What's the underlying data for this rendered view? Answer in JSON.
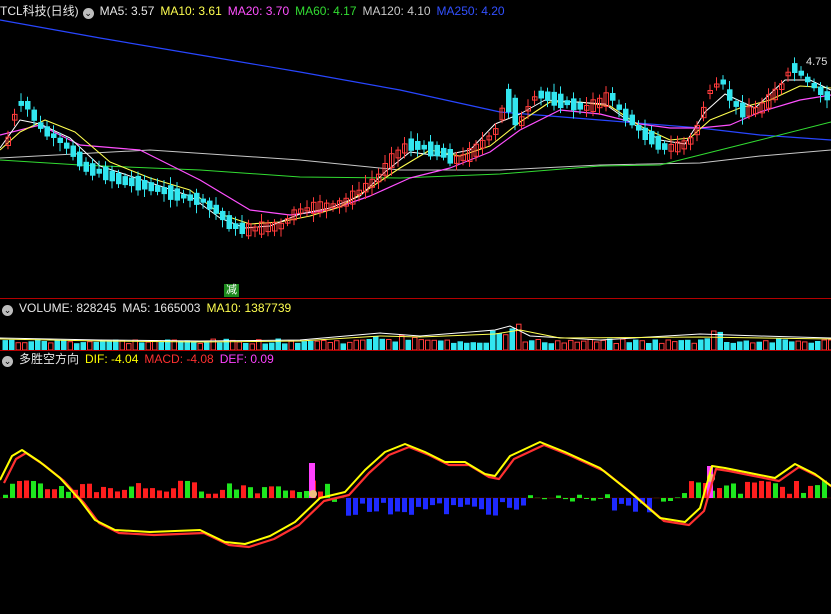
{
  "colors": {
    "background": "#000000",
    "up": "#ff3c3c",
    "down": "#32e6f0",
    "ma5": "#ffffff",
    "ma10": "#ffff50",
    "ma20": "#ff50ff",
    "ma60": "#32dc32",
    "ma120": "#c8c8c8",
    "ma250": "#2846ff",
    "dif": "#ffff00",
    "macd": "#ff3030",
    "def": "#ff40ff",
    "bar_red": "#ff1e1e",
    "bar_green": "#1ee61e",
    "bar_blue": "#1e2aff"
  },
  "header_price": {
    "title": "TCL科技(日线)",
    "ma5": "MA5: 3.57",
    "ma10": "MA10: 3.61",
    "ma20": "MA20: 3.70",
    "ma60": "MA60: 4.17",
    "ma120": "MA120: 4.10",
    "ma250": "MA250: 4.20"
  },
  "header_volume": {
    "volume": "VOLUME: 828245",
    "ma5": "MA5: 1665003",
    "ma10": "MA10: 1387739"
  },
  "header_macd": {
    "title": "多胜空方向",
    "dif": "DIF: -4.04",
    "macd": "MACD: -4.08",
    "def": "DEF: 0.09"
  },
  "annotations": {
    "high_label": "4.75",
    "reduce_tag": "减"
  },
  "chart_data": [
    {
      "type": "candlestick",
      "title": "TCL科技(日线)",
      "series": [
        {
          "name": "MA5",
          "value": 3.57
        },
        {
          "name": "MA10",
          "value": 3.61
        },
        {
          "name": "MA20",
          "value": 3.7
        },
        {
          "name": "MA60",
          "value": 4.17
        },
        {
          "name": "MA120",
          "value": 4.1
        },
        {
          "name": "MA250",
          "value": 4.2
        }
      ],
      "annotations": [
        "4.75"
      ]
    },
    {
      "type": "bar",
      "title": "VOLUME",
      "series": [
        {
          "name": "VOLUME",
          "value": 828245
        },
        {
          "name": "MA5",
          "value": 1665003
        },
        {
          "name": "MA10",
          "value": 1387739
        }
      ]
    },
    {
      "type": "line",
      "title": "多胜空方向",
      "series": [
        {
          "name": "DIF",
          "value": -4.04
        },
        {
          "name": "MACD",
          "value": -4.08
        },
        {
          "name": "DEF",
          "value": 0.09
        }
      ]
    }
  ]
}
